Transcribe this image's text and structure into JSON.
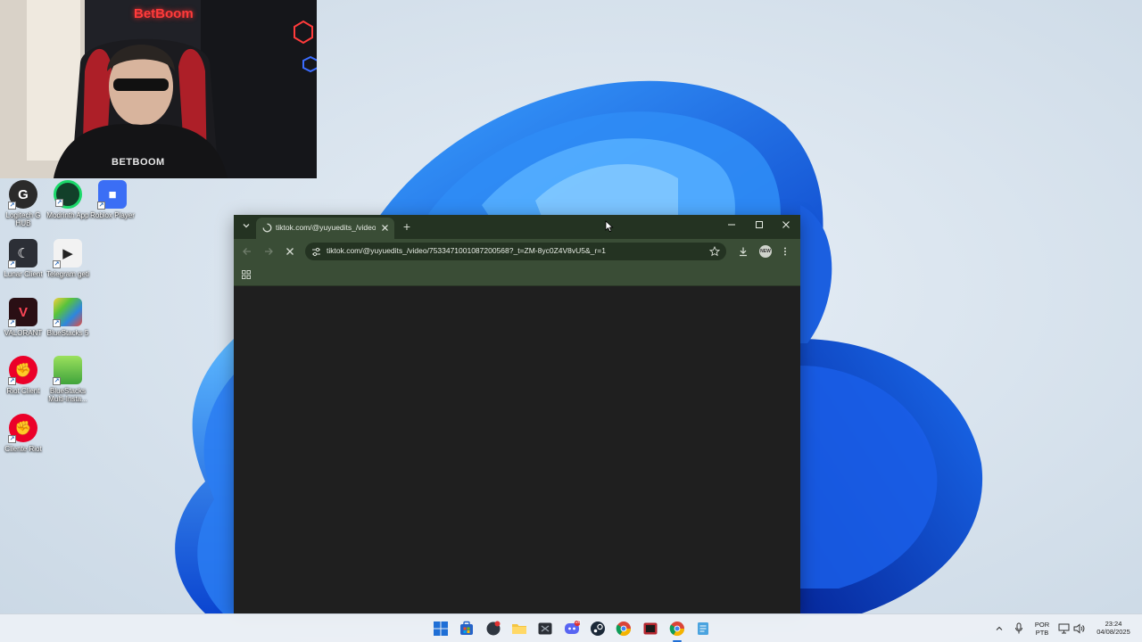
{
  "webcam": {
    "brand_sign": "BetBoom",
    "shirt_text": "BETBOOM"
  },
  "desktop": {
    "icons": [
      {
        "label": "Logitech G HUB",
        "icon": "logitech-g-hub-icon",
        "color": "#2b2b2b"
      },
      {
        "label": "Modrinth App",
        "icon": "modrinth-icon",
        "color": "#1bd96a"
      },
      {
        "label": "Roblox Player",
        "icon": "roblox-icon",
        "color": "#3b6ef5"
      },
      {
        "label": "Lunar Client",
        "icon": "lunar-client-icon",
        "color": "#2c2f36"
      },
      {
        "label": "Telegram geti",
        "icon": "telegram-icon",
        "color": "#f2f2f2"
      },
      {
        "label": "VALORANT",
        "icon": "valorant-icon",
        "color": "#fd4556"
      },
      {
        "label": "BlueStacks 5",
        "icon": "bluestacks-icon",
        "color": "#58c33b"
      },
      {
        "label": "Riot Client",
        "icon": "riot-client-icon",
        "color": "#eb0029"
      },
      {
        "label": "BlueStacks Multi-Insta...",
        "icon": "bluestacks-multi-icon",
        "color": "#7cc43a"
      },
      {
        "label": "Cliente Riot",
        "icon": "riot-client-icon",
        "color": "#eb0029"
      }
    ]
  },
  "browser": {
    "tab_title": "tiktok.com/@yuyuedits_/video/",
    "new_tab_symbol": "+",
    "url": "tiktok.com/@yuyuedits_/video/7533471001087200568?_t=ZM-8yc0Z4V8vU5&_r=1",
    "profile_badge": "NEW",
    "theme_color": "#3a4d36",
    "tabbar_color": "#243322"
  },
  "taskbar": {
    "apps": [
      {
        "name": "start",
        "icon": "windows-start-icon",
        "color": "#1f6fd6"
      },
      {
        "name": "store",
        "icon": "microsoft-store-icon",
        "color": "#2563c9"
      },
      {
        "name": "app",
        "icon": "game-app-icon",
        "color": "#2f3640"
      },
      {
        "name": "explorer",
        "icon": "file-explorer-icon",
        "color": "#f4c542"
      },
      {
        "name": "app2",
        "icon": "dark-app-icon",
        "color": "#2b2f36"
      },
      {
        "name": "discord",
        "icon": "discord-icon",
        "color": "#5865f2"
      },
      {
        "name": "steam",
        "icon": "steam-icon",
        "color": "#1b2838"
      },
      {
        "name": "chrome",
        "icon": "chrome-icon",
        "color": "#db4437"
      },
      {
        "name": "app3",
        "icon": "red-app-icon",
        "color": "#b3262e"
      },
      {
        "name": "chrome-active",
        "icon": "chrome-icon",
        "color": "#db4437"
      },
      {
        "name": "notepad",
        "icon": "notepad-icon",
        "color": "#4aa3df"
      }
    ],
    "discord_badge": "20",
    "lang_top": "POR",
    "lang_bottom": "PTB",
    "time": "23:24",
    "date": "04/08/2025"
  }
}
